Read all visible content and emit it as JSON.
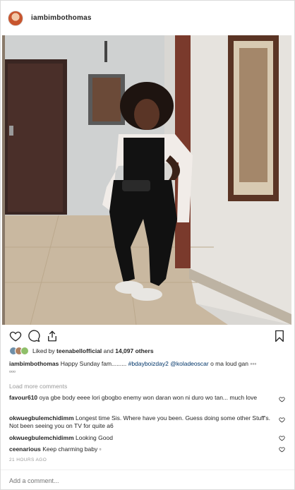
{
  "header": {
    "username": "iambimbothomas"
  },
  "photo": {
    "alt": "post-photo"
  },
  "actions": {
    "like_icon": "heart-icon",
    "comment_icon": "comment-icon",
    "share_icon": "share-icon",
    "save_icon": "bookmark-icon"
  },
  "likes": {
    "prefix": "Liked by",
    "user": "teenabellofficial",
    "connector": "and",
    "count": "14,097 others"
  },
  "caption": {
    "username": "iambimbothomas",
    "text_a": "Happy Sunday fam......... ",
    "hashtag": "#bdayboizday2",
    "mention": "@koladeoscar",
    "text_b": " o ma loud gan ",
    "emoji_a": "▫▫▫",
    "emoji_b": "▫▫▫"
  },
  "load_more": "Load more comments",
  "comments": [
    {
      "username": "favour610",
      "text": "oya gbe body eeee lori gbogbo enemy won daran won ni duro wo tan... much love"
    },
    {
      "username": "okwuegbulemchidimm",
      "text": "Longest time Sis. Where have you been. Guess doing some other Stuff's. Not been seeing you on TV for quite a6"
    },
    {
      "username": "okwuegbulemchidimm",
      "text": "Looking Good"
    },
    {
      "username": "ceenarious",
      "text": "Keep charming baby ▫"
    }
  ],
  "timestamp": "21 HOURS AGO",
  "add_comment": {
    "placeholder": "Add a comment..."
  }
}
